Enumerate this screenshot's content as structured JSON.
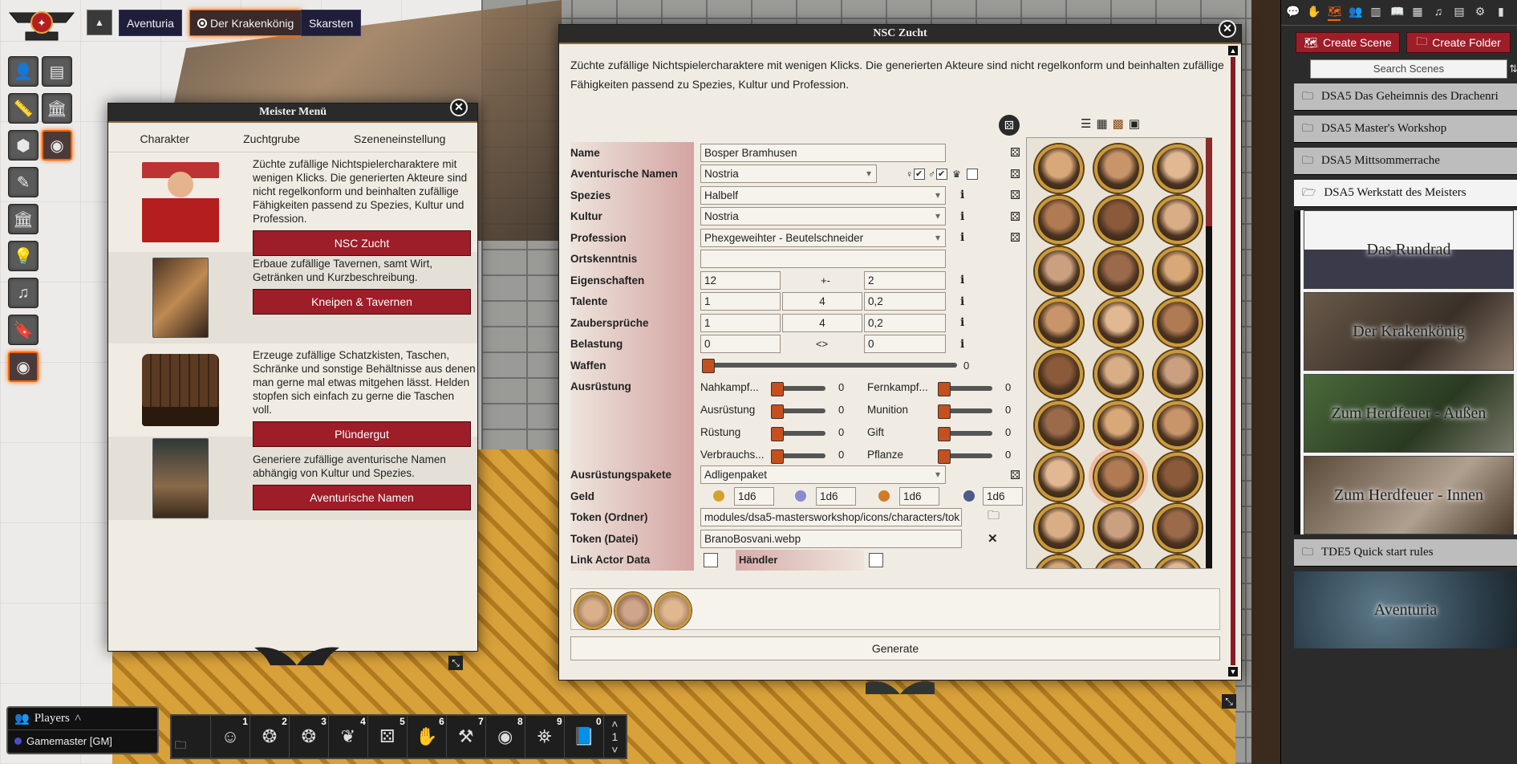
{
  "nav": {
    "scenes": [
      {
        "label": "Aventuria"
      },
      {
        "label": "Der Krakenkönig",
        "active": true
      },
      {
        "label": "Skarsten"
      }
    ]
  },
  "meister": {
    "title": "Meister Menü",
    "tabs": [
      "Charakter",
      "Zuchtgrube",
      "Szeneneinstellung"
    ],
    "rows": [
      {
        "desc": "Züchte zufällige Nichtspielercharaktere mit wenigen Klicks. Die generierten Akteure sind nicht regelkonform und beinhalten zufällige Fähigkeiten passend zu Spezies, Kultur und Profession.",
        "button": "NSC Zucht"
      },
      {
        "desc": "Erbaue zufällige Tavernen, samt Wirt, Getränken und Kurzbeschreibung.",
        "button": "Kneipen & Tavernen"
      },
      {
        "desc": "Erzeuge zufällige Schatzkisten, Taschen, Schränke und sonstige Behältnisse aus denen man gerne mal etwas mitgehen lässt. Helden stopfen sich einfach zu gerne die Taschen voll.",
        "button": "Plündergut"
      },
      {
        "desc": "Generiere zufällige aventurische Namen abhängig von Kultur und Spezies.",
        "button": "Aventurische Namen"
      }
    ]
  },
  "nsc": {
    "title": "NSC Zucht",
    "intro": "Züchte zufällige Nichtspielercharaktere mit wenigen Klicks. Die generierten Akteure sind nicht regelkonform und beinhalten zufällige Fähigkeiten passend zu Spezies, Kultur und Profession.",
    "labels": {
      "name": "Name",
      "avnames": "Aventurische Namen",
      "spezies": "Spezies",
      "kultur": "Kultur",
      "profession": "Profession",
      "ortskenntnis": "Ortskenntnis",
      "eigenschaften": "Eigenschaften",
      "talente": "Talente",
      "zauber": "Zaubersprüche",
      "belastung": "Belastung",
      "waffen": "Waffen",
      "ausruestung": "Ausrüstung",
      "pakete": "Ausrüstungspakete",
      "geld": "Geld",
      "token_ordner": "Token (Ordner)",
      "token_datei": "Token (Datei)",
      "link": "Link Actor Data",
      "haendler": "Händler"
    },
    "values": {
      "name": "Bosper Bramhusen",
      "avnames": "Nostria",
      "spezies": "Halbelf",
      "kultur": "Nostria",
      "profession": "Phexgeweihter - Beutelschneider",
      "ortskenntnis": "",
      "eig_a": "12",
      "eig_op": "+-",
      "eig_b": "2",
      "tal_a": "1",
      "tal_b": "4",
      "tal_c": "0,2",
      "zau_a": "1",
      "zau_b": "4",
      "zau_c": "0,2",
      "bel_a": "0",
      "bel_op": "<>",
      "bel_b": "0",
      "waffen": "0",
      "pakete": "Adligenpaket",
      "geld": [
        "1d6",
        "1d6",
        "1d6",
        "1d6"
      ],
      "token_ordner": "modules/dsa5-mastersworkshop/icons/characters/tok",
      "token_datei": "BranoBosvani.webp"
    },
    "equipment": [
      {
        "label": "Nahkampf...",
        "value": "0"
      },
      {
        "label": "Fernkampf...",
        "value": "0"
      },
      {
        "label": "Ausrüstung",
        "value": "0"
      },
      {
        "label": "Munition",
        "value": "0"
      },
      {
        "label": "Rüstung",
        "value": "0"
      },
      {
        "label": "Gift",
        "value": "0"
      },
      {
        "label": "Verbrauchs...",
        "value": "0"
      },
      {
        "label": "Pflanze",
        "value": "0"
      }
    ],
    "info": "i",
    "generate": "Generate"
  },
  "sidebar": {
    "create_scene": "Create Scene",
    "create_folder": "Create Folder",
    "search_placeholder": "Search Scenes",
    "folders": [
      "DSA5 Das Geheimnis des Drachenri",
      "DSA5 Master's Workshop",
      "DSA5 Mittsommerrache",
      "DSA5 Werkstatt des Meisters"
    ],
    "scenes": [
      "Das Rundrad",
      "Der Krakenkönig",
      "Zum Herdfeuer - Außen",
      "Zum Herdfeuer - Innen"
    ],
    "folder_after": "TDE5 Quick start rules",
    "aventuria": "Aventuria"
  },
  "players": {
    "title": "Players",
    "user": "Gamemaster [GM]"
  },
  "hotbar": [
    "1",
    "2",
    "3",
    "4",
    "5",
    "6",
    "7",
    "8",
    "9",
    "0"
  ],
  "hotbar_page": "1",
  "colors": {
    "accent": "#ff6400",
    "button_red": "#9d1d28"
  }
}
